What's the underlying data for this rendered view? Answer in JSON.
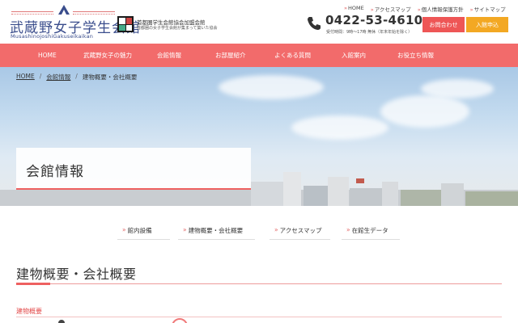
{
  "header": {
    "logo_title": "武蔵野女子学生会館",
    "logo_roman": "MusashinojoshiGakuseikaikan",
    "association_name": "首都圏学生会館協会加盟会館",
    "association_sub": "首都圏の女子学生会館が集まって築いた協会",
    "phone_number": "0422-53-4610",
    "phone_hours": "受付時間：9時〜17時 無休（年末年始を除く）",
    "top_links": [
      {
        "label": "HOME"
      },
      {
        "label": "アクセスマップ"
      },
      {
        "label": "個人情報保護方針"
      },
      {
        "label": "サイトマップ"
      }
    ],
    "contact_button": "お問合わせ",
    "apply_button": "入館申込"
  },
  "nav": {
    "items": [
      {
        "label": "HOME"
      },
      {
        "label": "武蔵野女子の魅力"
      },
      {
        "label": "会館情報"
      },
      {
        "label": "お部屋紹介"
      },
      {
        "label": "よくある質問"
      },
      {
        "label": "入館案内"
      },
      {
        "label": "お役立ち情報"
      }
    ]
  },
  "breadcrumb": {
    "home": "HOME",
    "sep": "/",
    "parent": "会館情報",
    "current": "建物概要・会社概要"
  },
  "page_title": "会館情報",
  "subtabs": [
    {
      "label": "館内設備"
    },
    {
      "label": "建物概要・会社概要"
    },
    {
      "label": "アクセスマップ"
    },
    {
      "label": "在館生データ"
    }
  ],
  "section": {
    "title": "建物概要・会社概要",
    "sub_heading": "建物概要"
  },
  "colors": {
    "nav_bg": "#f26b6b",
    "accent_red": "#ee5656",
    "accent_orange": "#f3a823",
    "logo_blue": "#3a4d8c"
  },
  "icons": {
    "logo": "logo-mountain-icon",
    "phone": "phone-icon",
    "link_arrow": "chevron-right-icon"
  }
}
